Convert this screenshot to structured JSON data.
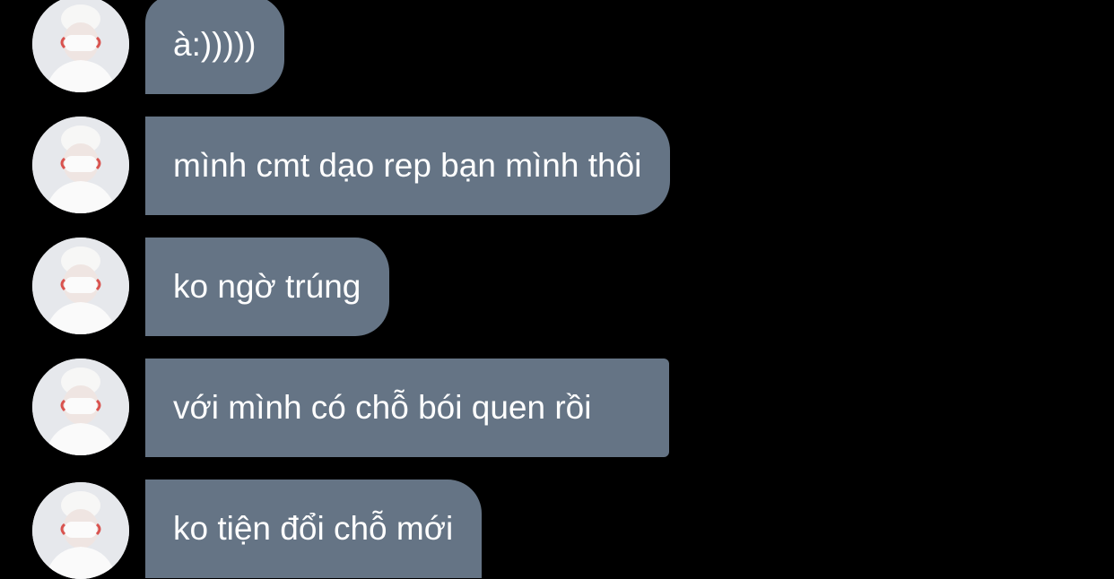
{
  "conversation": {
    "messages": [
      {
        "text": "à:)))))"
      },
      {
        "text": "mình cmt dạo rep bạn mình thôi"
      },
      {
        "text": "ko ngờ trúng"
      },
      {
        "text": "với mình có chỗ bói quen rồi"
      },
      {
        "text": "ko tiện đổi chỗ mới"
      }
    ]
  },
  "colors": {
    "background": "#000000",
    "bubble": "#657485",
    "bubble_text": "#ffffff"
  },
  "icons": {
    "avatar": "avatar-person-white-hat-mask"
  }
}
